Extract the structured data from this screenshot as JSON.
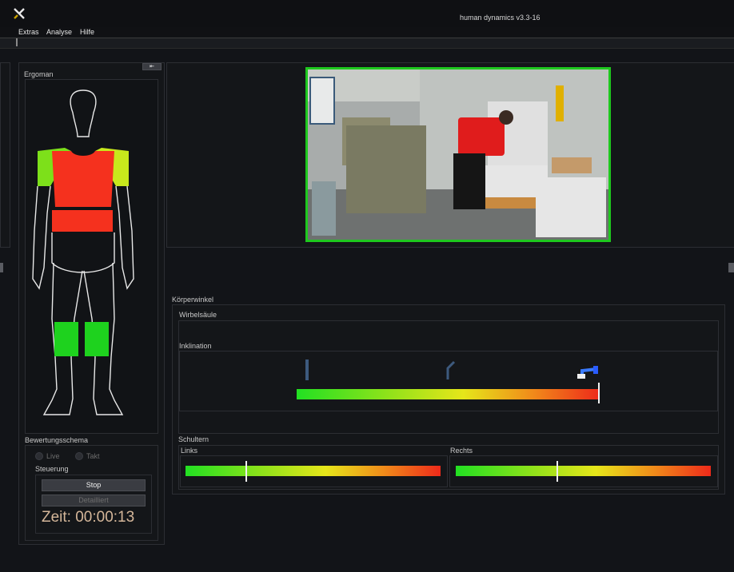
{
  "window": {
    "title": "human dynamics v3.3-16"
  },
  "menu": [
    "Extras",
    "Analyse",
    "Hilfe"
  ],
  "ergoman": {
    "title": "Ergoman",
    "collapse_button": "⇤",
    "zones": [
      {
        "name": "left-shoulder",
        "color": "#7de01a"
      },
      {
        "name": "right-shoulder",
        "color": "#c8e81c"
      },
      {
        "name": "upper-torso",
        "color": "#f5311e"
      },
      {
        "name": "lower-torso",
        "color": "#f5311e"
      },
      {
        "name": "left-knee",
        "color": "#1ed21e"
      },
      {
        "name": "right-knee",
        "color": "#1ed21e"
      }
    ]
  },
  "bewertung": {
    "title": "Bewertungsschema",
    "options": [
      {
        "label": "Live",
        "selected": false
      },
      {
        "label": "Takt",
        "selected": false
      }
    ],
    "steuerung_title": "Steuerung",
    "stop_label": "Stop",
    "detailliert_label": "Detailliert",
    "time_text": "Zeit: 00:00:13"
  },
  "video": {
    "frame_color": "#1ec81e"
  },
  "koerperwinkel": {
    "title": "Körperwinkel",
    "wirbelsaeule": {
      "title": "Wirbelsäule",
      "inklination": {
        "title": "Inklination",
        "value": 1.0
      }
    },
    "schultern": {
      "title": "Schultern",
      "links": {
        "title": "Links",
        "value": 0.24
      },
      "rechts": {
        "title": "Rechts",
        "value": 0.4
      }
    }
  }
}
